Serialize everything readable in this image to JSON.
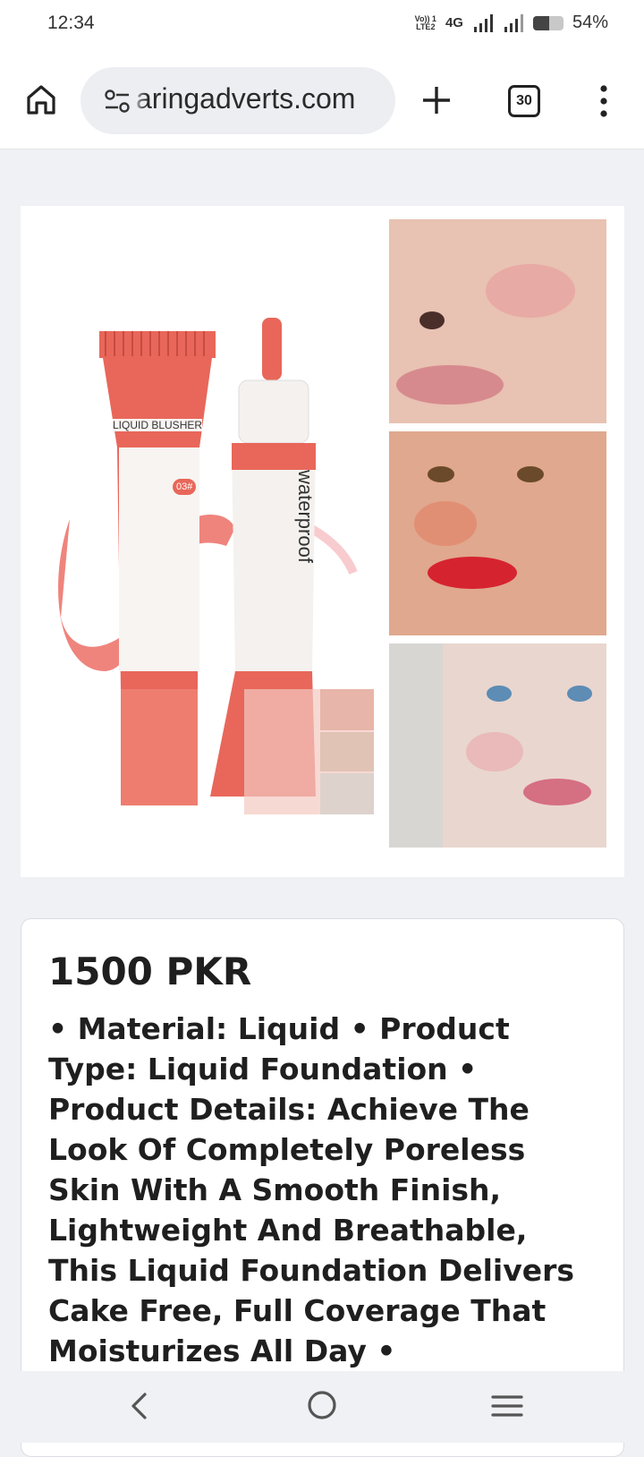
{
  "status_bar": {
    "time": "12:34",
    "volte": "Vo)) 1\nLTE2",
    "network": "4G",
    "battery_percent": "54%",
    "battery_level": 0.54
  },
  "browser": {
    "url": "aringadverts.com",
    "tab_count": "30",
    "icons": [
      "home-icon",
      "site-settings-icon",
      "plus-icon",
      "tab-switcher-icon",
      "more-vert-icon"
    ]
  },
  "product": {
    "image_label": "LIQUID BLUSHER",
    "brand_text": "waterproof",
    "shade": "03#",
    "price": "1500 PKR",
    "description": "• Material: Liquid • Product Type: Liquid Foundation • Product Details: Achieve The Look Of Completely Poreless Skin With A Smooth Finish, Lightweight And Breathable, This Liquid Foundation Delivers Cake Free, Full Coverage That Moisturizes All Day •"
  },
  "colors": {
    "tube_coral": "#e8675a",
    "tube_light": "#f08a7c",
    "lip_red": "#d62330",
    "accent_dark": "#1f1f1f"
  },
  "nav": {
    "icons": [
      "back-icon",
      "home-circle-icon",
      "recents-icon"
    ]
  }
}
